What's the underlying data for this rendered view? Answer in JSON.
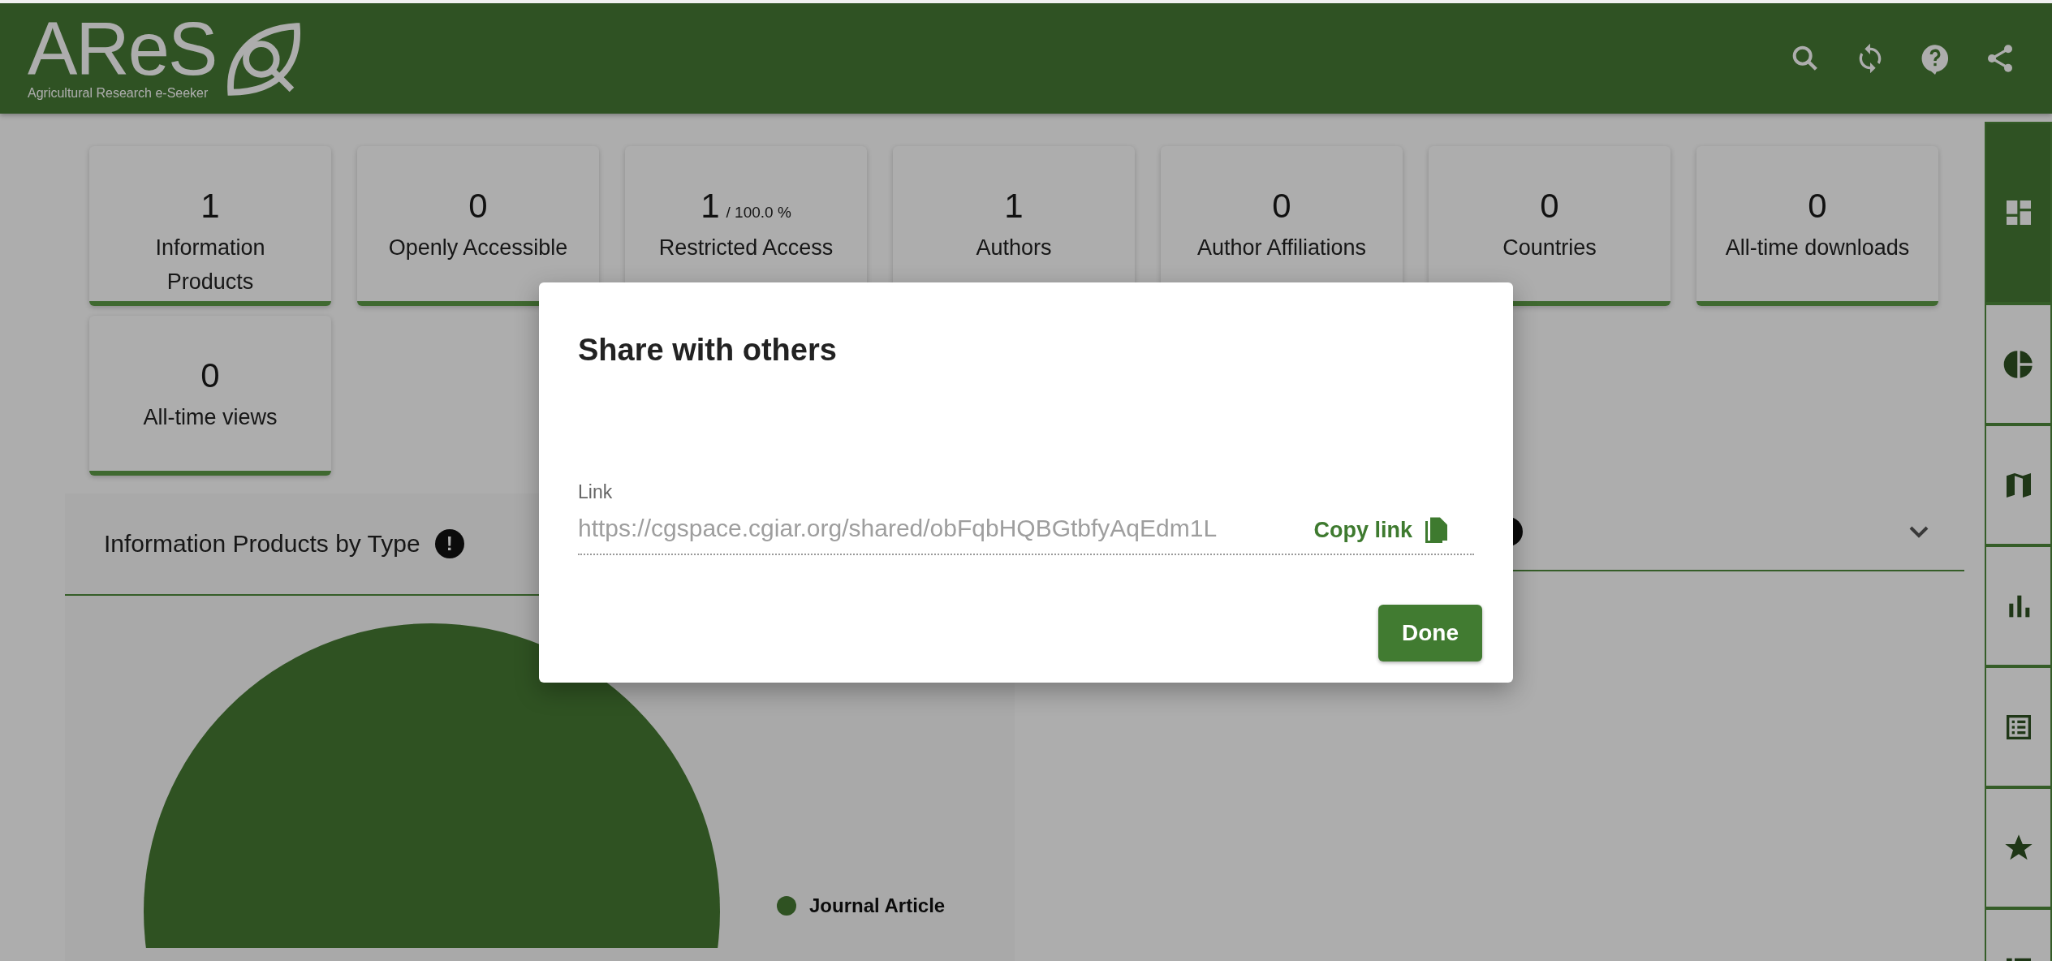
{
  "header": {
    "logo": "AReS",
    "tagline": "Agricultural Research e-Seeker"
  },
  "stats": [
    {
      "value": "1",
      "label": "Information Products"
    },
    {
      "value": "0",
      "label": "Openly Accessible"
    },
    {
      "value": "1",
      "suffix": "/ 100.0 %",
      "label": "Restricted Access"
    },
    {
      "value": "1",
      "label": "Authors"
    },
    {
      "value": "0",
      "label": "Author Affiliations"
    },
    {
      "value": "0",
      "label": "Countries"
    },
    {
      "value": "0",
      "label": "All-time downloads"
    },
    {
      "value": "0",
      "label": "All-time views"
    }
  ],
  "panels": [
    {
      "title": "Information Products by Type",
      "info": "!",
      "legend": [
        {
          "label": "Journal Article",
          "color": "#2f5222"
        }
      ]
    },
    {
      "info_icon": true
    }
  ],
  "sidebar": {
    "items": [
      {
        "selected": true
      },
      {
        "selected": false
      },
      {
        "selected": false
      },
      {
        "selected": false
      },
      {
        "selected": false
      },
      {
        "selected": false
      },
      {
        "selected": false
      }
    ]
  },
  "dialog": {
    "title": "Share with others",
    "field": {
      "label": "Link",
      "value": "https://cgspace.cgiar.org/shared/obFqbHQBGtbfyAqEdm1L"
    },
    "copy_button": "Copy link",
    "done_button": "Done"
  }
}
